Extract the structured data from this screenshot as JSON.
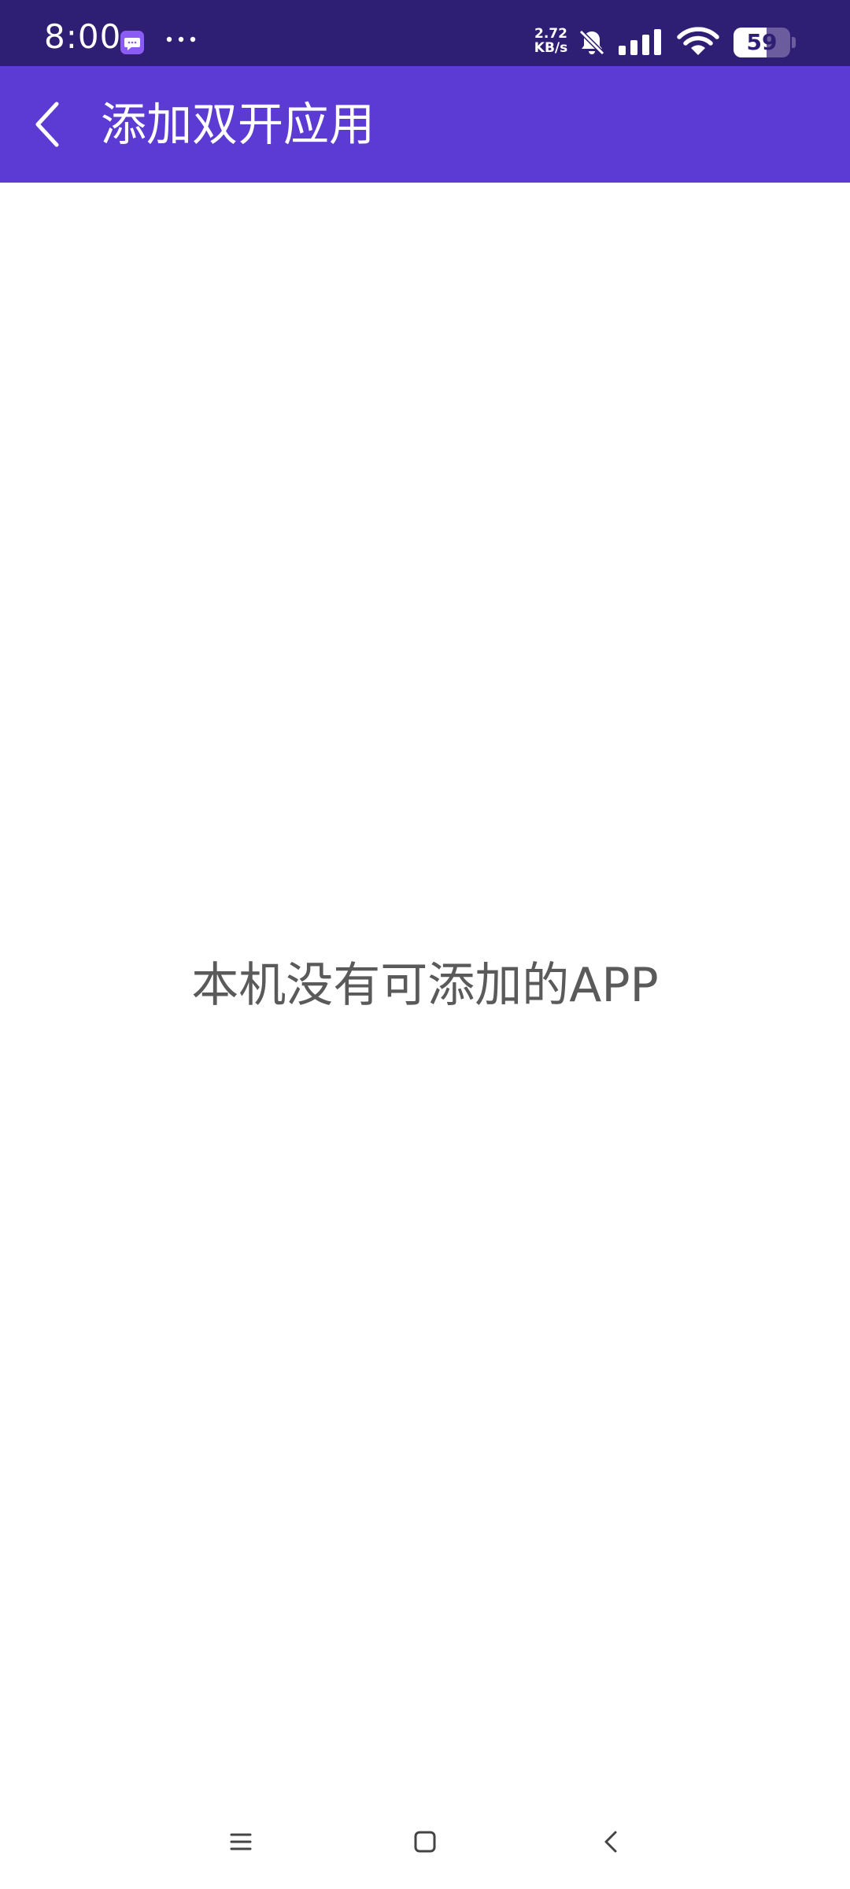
{
  "status_bar": {
    "time": "8:00",
    "net_speed_value": "2.72",
    "net_speed_unit": "KB/s",
    "battery_level": "59",
    "battery_fraction": 0.59,
    "icons": [
      "message-app-icon",
      "more-dots-icon",
      "bell-muted-icon",
      "signal-icon",
      "wifi-icon",
      "battery-icon"
    ]
  },
  "app_bar": {
    "title": "添加双开应用",
    "back_icon": "chevron-left-icon"
  },
  "content": {
    "empty_message": "本机没有可添加的APP"
  },
  "nav_bar": {
    "icons": [
      "menu-icon",
      "home-square-icon",
      "back-chevron-icon"
    ]
  },
  "colors": {
    "status_bar": "#2f1f74",
    "app_bar": "#5c3ad4",
    "background": "#ffffff",
    "message_text": "#5a5a5a",
    "nav_icons": "#444444"
  }
}
